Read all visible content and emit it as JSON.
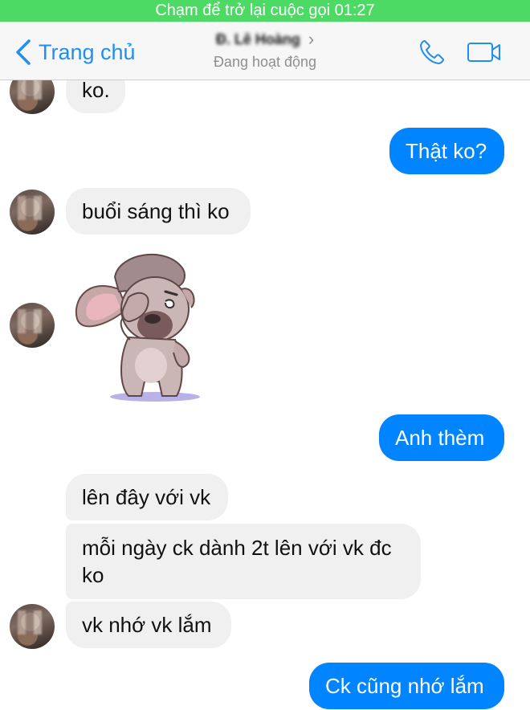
{
  "call_banner": {
    "text": "Chạm để trở lại cuộc gọi 01:27"
  },
  "header": {
    "back_label": "Trang chủ",
    "contact_name": "Đ. Lê Hoàng",
    "status": "Đang hoạt động",
    "icons": [
      "chevron-left-icon",
      "phone-icon",
      "video-camera-icon"
    ],
    "accent_color": "#1f8ff0"
  },
  "messages": [
    {
      "from": "them",
      "text": "ko."
    },
    {
      "from": "me",
      "text": "Thật ko?"
    },
    {
      "from": "them",
      "text": "buổi sáng thì ko"
    },
    {
      "from": "them",
      "type": "sticker",
      "sticker": "dog-facepalm-sticker"
    },
    {
      "from": "me",
      "text": "Anh thèm"
    },
    {
      "from": "them",
      "text": "lên đây với vk"
    },
    {
      "from": "them",
      "text": "mỗi ngày ck dành 2t lên với vk đc ko"
    },
    {
      "from": "them",
      "text": "vk nhớ vk lắm"
    },
    {
      "from": "me",
      "text": "Ck cũng nhớ lắm"
    }
  ],
  "colors": {
    "incoming_bubble": "#f1f0f0",
    "outgoing_bubble": "#0084ff",
    "call_banner": "#4cd964"
  }
}
